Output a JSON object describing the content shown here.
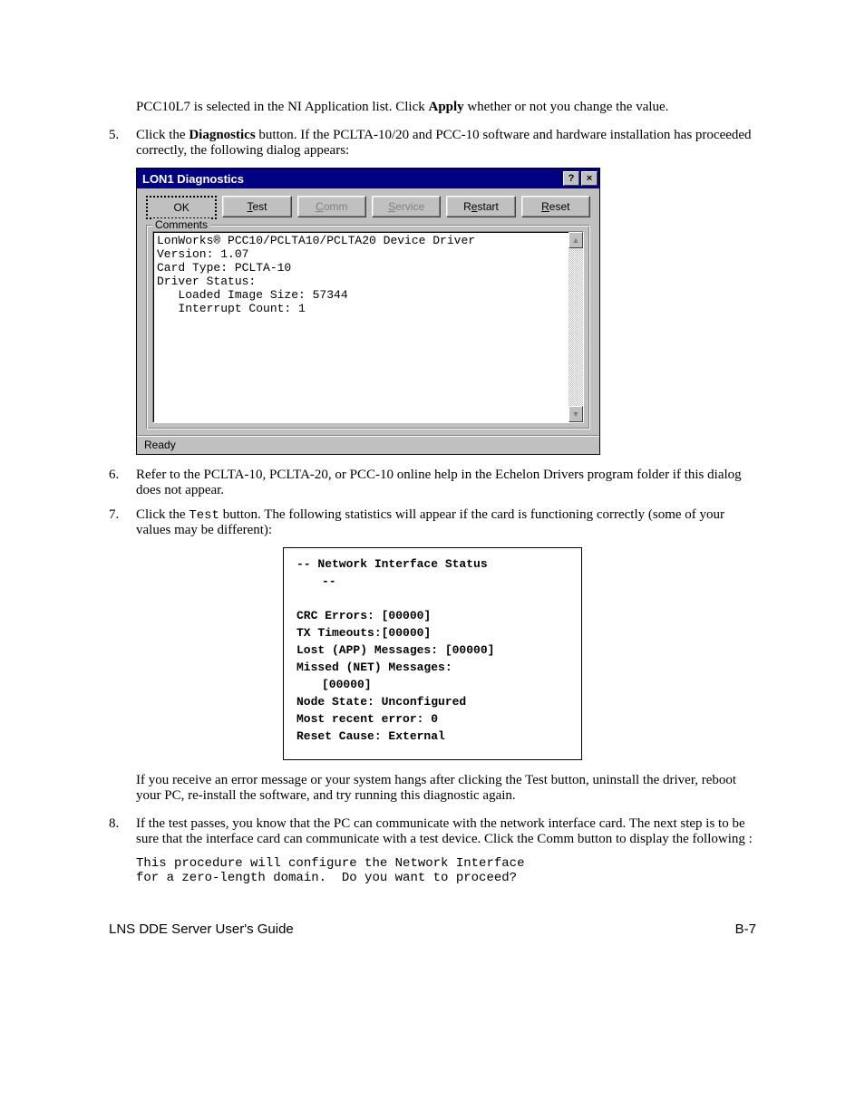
{
  "intro": {
    "pcc_line": "PCC10L7 is selected in the NI Application list. Click ",
    "apply": "Apply",
    "pcc_line2": " whether or not you change the value."
  },
  "steps": {
    "s5_num": "5.",
    "s5a": "Click the ",
    "s5_diag": "Diagnostics",
    "s5b": " button.  If the PCLTA-10/20 and PCC-10 software and hardware installation has proceeded correctly, the following dialog appears:",
    "s6_num": "6.",
    "s6": "Refer to the PCLTA-10, PCLTA-20, or PCC-10 online help in the Echelon Drivers program folder if this dialog does not appear.",
    "s7_num": "7.",
    "s7a": "Click the ",
    "s7_test": "Test",
    "s7b": " button.  The following statistics will appear if the card is functioning correctly (some of your values may be different):",
    "s7_after": "If you receive an error message or your system hangs after clicking the Test button, uninstall the driver, reboot your PC, re-install the software, and try running this diagnostic again.",
    "s8_num": "8.",
    "s8": "If the test passes, you know that the PC can communicate with the network interface card.  The next step is to be sure that the interface card can communicate with a test device.  Click the Comm button to display the following :"
  },
  "dialog": {
    "title": "LON1 Diagnostics",
    "help_glyph": "?",
    "close_glyph": "×",
    "buttons": {
      "ok": "OK",
      "test_u": "T",
      "test_rest": "est",
      "comm_u": "C",
      "comm_rest": "omm",
      "service_u": "S",
      "service_rest": "ervice",
      "restart_pre": "R",
      "restart_u": "e",
      "restart_rest": "start",
      "reset_u": "R",
      "reset_rest": "eset"
    },
    "group_label": "Comments",
    "textarea": "LonWorks® PCC10/PCLTA10/PCLTA20 Device Driver\nVersion: 1.07\nCard Type: PCLTA-10\nDriver Status:\n   Loaded Image Size: 57344\n   Interrupt Count: 1",
    "scroll_up": "▲",
    "scroll_down": "▼",
    "status": "Ready"
  },
  "stats": {
    "header": "-- Network Interface Status",
    "dashes": "--",
    "lines": [
      "CRC Errors: [00000]",
      "TX Timeouts:[00000]",
      "Lost (APP) Messages: [00000]",
      "Missed (NET) Messages:",
      "[00000]",
      "Node State: Unconfigured",
      "Most recent error: 0",
      "Reset Cause: External"
    ]
  },
  "code": "This procedure will configure the Network Interface\nfor a zero-length domain.  Do you want to proceed?",
  "footer": {
    "left": "LNS DDE Server User's Guide",
    "right": "B-7"
  }
}
